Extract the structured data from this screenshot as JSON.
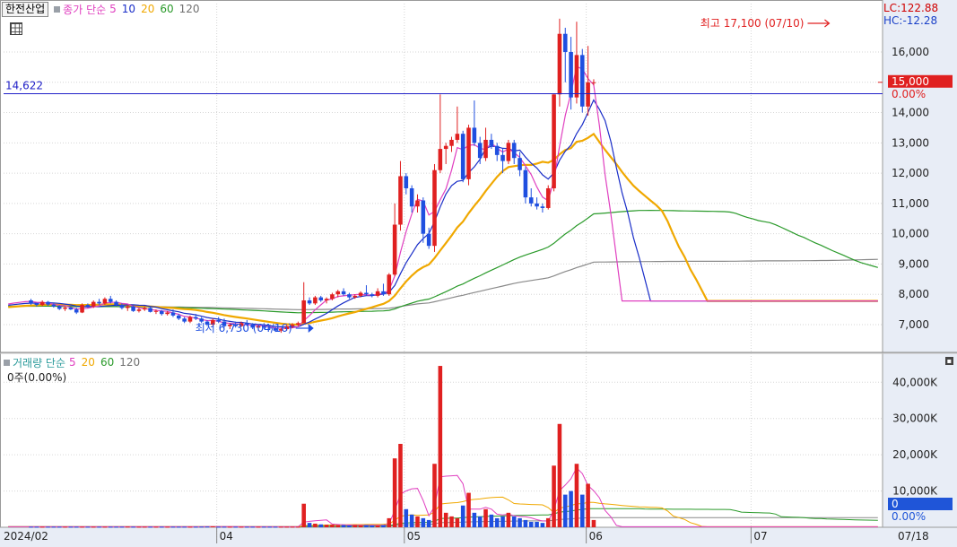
{
  "legend": {
    "stock_name": "한전산업",
    "price_label": "종가 단순",
    "ma": [
      "5",
      "10",
      "20",
      "60",
      "120"
    ]
  },
  "right_top": {
    "lc": "LC:122.88",
    "hc": "HC:-12.28"
  },
  "volume_legend": {
    "label": "거래량 단순",
    "ma": [
      "5",
      "20",
      "60",
      "120"
    ],
    "sub": "0주(0.00%)"
  },
  "colors": {
    "up": "#e02020",
    "down": "#1f4fe0",
    "ma5": "#e040c0",
    "ma10": "#1a2ec8",
    "ma20": "#f0a800",
    "ma60": "#2a9a2a",
    "ma120": "#8a8a8a",
    "hline": "#2020c8"
  },
  "chart_data": {
    "type": "candlestick",
    "price_axis": {
      "ticks": [
        "16,000",
        "15,000",
        "14,000",
        "13,000",
        "12,000",
        "11,000",
        "10,000",
        "9,000",
        "8,000",
        "7,000"
      ],
      "tick_values": [
        16000,
        15000,
        14000,
        13000,
        12000,
        11000,
        10000,
        9000,
        8000,
        7000
      ],
      "range": [
        6230,
        17480
      ]
    },
    "volume_axis": {
      "ticks": [
        "40,000K",
        "30,000K",
        "20,000K",
        "10,000K"
      ],
      "tick_values": [
        40000,
        30000,
        20000,
        10000
      ],
      "range": [
        0,
        46000
      ]
    },
    "x_labels": [
      "2024/02",
      "04",
      "05",
      "06",
      "07",
      "07/18"
    ],
    "x_label_index": [
      0,
      37,
      70,
      102,
      131,
      153
    ],
    "n_days": 154,
    "first_index": 4,
    "current_price": "15,000",
    "current_price_pct": "0.00%",
    "current_volume": "0",
    "current_volume_pct": "0.00%",
    "reference_line": {
      "value": 14622,
      "label": "14,622"
    },
    "high_annotation": {
      "text": "최고 17,100 (07/10)",
      "value": 17100,
      "index": 146
    },
    "low_annotation": {
      "text": "최저 6,730 (04/16)",
      "value": 6730,
      "index": 55
    },
    "candles": [
      [
        7800,
        7850,
        7650,
        7700
      ],
      [
        7700,
        7720,
        7600,
        7650
      ],
      [
        7650,
        7800,
        7600,
        7750
      ],
      [
        7750,
        7780,
        7620,
        7660
      ],
      [
        7660,
        7700,
        7560,
        7600
      ],
      [
        7600,
        7640,
        7480,
        7520
      ],
      [
        7520,
        7600,
        7450,
        7560
      ],
      [
        7560,
        7600,
        7480,
        7500
      ],
      [
        7500,
        7560,
        7350,
        7400
      ],
      [
        7400,
        7700,
        7380,
        7650
      ],
      [
        7650,
        7700,
        7550,
        7600
      ],
      [
        7600,
        7800,
        7550,
        7750
      ],
      [
        7750,
        7850,
        7650,
        7700
      ],
      [
        7700,
        7900,
        7650,
        7850
      ],
      [
        7850,
        7950,
        7700,
        7750
      ],
      [
        7750,
        7800,
        7600,
        7650
      ],
      [
        7650,
        7700,
        7500,
        7550
      ],
      [
        7550,
        7650,
        7450,
        7600
      ],
      [
        7600,
        7620,
        7420,
        7450
      ],
      [
        7450,
        7550,
        7400,
        7500
      ],
      [
        7500,
        7600,
        7450,
        7550
      ],
      [
        7550,
        7600,
        7400,
        7420
      ],
      [
        7420,
        7500,
        7350,
        7450
      ],
      [
        7450,
        7480,
        7300,
        7350
      ],
      [
        7350,
        7450,
        7300,
        7400
      ],
      [
        7400,
        7500,
        7250,
        7300
      ],
      [
        7300,
        7350,
        7150,
        7200
      ],
      [
        7200,
        7250,
        7050,
        7100
      ],
      [
        7100,
        7300,
        7050,
        7250
      ],
      [
        7250,
        7350,
        7150,
        7200
      ],
      [
        7200,
        7250,
        7050,
        7100
      ],
      [
        7100,
        7150,
        6950,
        7000
      ],
      [
        7000,
        7200,
        6950,
        7150
      ],
      [
        7150,
        7250,
        7050,
        7100
      ],
      [
        7100,
        7200,
        6900,
        6950
      ],
      [
        6950,
        7050,
        6850,
        7000
      ],
      [
        7000,
        7100,
        6900,
        6950
      ],
      [
        6950,
        7100,
        6920,
        7050
      ],
      [
        7050,
        7150,
        6950,
        7000
      ],
      [
        7000,
        7050,
        6850,
        6900
      ],
      [
        6900,
        7000,
        6800,
        6950
      ],
      [
        6950,
        7050,
        6850,
        6900
      ],
      [
        6900,
        7000,
        6820,
        6880
      ],
      [
        6880,
        6950,
        6760,
        6800
      ],
      [
        6800,
        6900,
        6730,
        6850
      ],
      [
        6850,
        7000,
        6800,
        6950
      ],
      [
        6950,
        7050,
        6880,
        7000
      ],
      [
        7000,
        7100,
        6950,
        7050
      ],
      [
        7050,
        8400,
        7050,
        7800
      ],
      [
        7800,
        7900,
        7650,
        7700
      ],
      [
        7700,
        7950,
        7650,
        7900
      ],
      [
        7900,
        7950,
        7750,
        7800
      ],
      [
        7800,
        7900,
        7700,
        7850
      ],
      [
        7850,
        8050,
        7800,
        8000
      ],
      [
        8000,
        8150,
        7900,
        8100
      ],
      [
        8100,
        8200,
        7950,
        8000
      ],
      [
        8000,
        8050,
        7850,
        7900
      ],
      [
        7900,
        8000,
        7850,
        7950
      ],
      [
        7950,
        8100,
        7900,
        8050
      ],
      [
        8050,
        8300,
        7950,
        8000
      ],
      [
        8000,
        8050,
        7900,
        7950
      ],
      [
        7950,
        8200,
        7900,
        8100
      ],
      [
        8100,
        8350,
        7950,
        8000
      ],
      [
        8000,
        8700,
        7950,
        8650
      ],
      [
        8650,
        11000,
        8600,
        10300
      ],
      [
        10300,
        12400,
        10100,
        11900
      ],
      [
        11900,
        12000,
        11300,
        11500
      ],
      [
        11500,
        11600,
        10700,
        10900
      ],
      [
        10900,
        11300,
        10700,
        11100
      ],
      [
        11100,
        11200,
        9700,
        10000
      ],
      [
        10000,
        10200,
        9500,
        9600
      ],
      [
        9600,
        12300,
        9400,
        12100
      ],
      [
        12100,
        14600,
        12000,
        12800
      ],
      [
        12800,
        13000,
        12300,
        12900
      ],
      [
        12900,
        13200,
        12700,
        13100
      ],
      [
        13100,
        14200,
        13000,
        13300
      ],
      [
        13300,
        13400,
        11700,
        11800
      ],
      [
        11800,
        13600,
        11600,
        13500
      ],
      [
        13500,
        14400,
        12900,
        13000
      ],
      [
        13000,
        13200,
        12300,
        12500
      ],
      [
        12500,
        13500,
        12400,
        13100
      ],
      [
        13100,
        13300,
        12800,
        12900
      ],
      [
        12900,
        13000,
        12400,
        12600
      ],
      [
        12600,
        12800,
        12000,
        12400
      ],
      [
        12400,
        13100,
        12300,
        13000
      ],
      [
        13000,
        13100,
        12300,
        12500
      ],
      [
        12500,
        12700,
        11900,
        12100
      ],
      [
        12100,
        12200,
        11000,
        11200
      ],
      [
        11200,
        11500,
        10900,
        11000
      ],
      [
        11000,
        11200,
        10800,
        10900
      ],
      [
        10900,
        11000,
        10700,
        10850
      ],
      [
        10850,
        11600,
        10800,
        11500
      ],
      [
        11500,
        14600,
        11400,
        14600
      ],
      [
        14600,
        17100,
        14200,
        16600
      ],
      [
        16600,
        16800,
        15000,
        16000
      ],
      [
        16000,
        16500,
        14100,
        14500
      ],
      [
        14500,
        17000,
        14300,
        15900
      ],
      [
        15900,
        16100,
        14000,
        14200
      ],
      [
        14200,
        16200,
        13900,
        15000
      ],
      [
        15000,
        15100,
        14900,
        15000
      ]
    ],
    "volume": [
      150,
      150,
      150,
      150,
      150,
      150,
      150,
      150,
      150,
      150,
      150,
      150,
      150,
      150,
      150,
      150,
      150,
      180,
      150,
      150,
      150,
      150,
      150,
      150,
      150,
      150,
      150,
      150,
      150,
      150,
      180,
      200,
      250,
      150,
      150,
      150,
      150,
      150,
      150,
      150,
      150,
      150,
      150,
      150,
      150,
      150,
      150,
      150,
      6500,
      1200,
      1000,
      800,
      700,
      700,
      600,
      600,
      500,
      600,
      500,
      600,
      500,
      500,
      600,
      2500,
      19000,
      23000,
      5000,
      3500,
      3000,
      2500,
      2000,
      17500,
      44500,
      4000,
      3000,
      2500,
      6000,
      9500,
      4000,
      3000,
      5000,
      3500,
      2500,
      3000,
      4000,
      3000,
      2500,
      2000,
      1500,
      1500,
      1200,
      2500,
      17000,
      28500,
      9000,
      10000,
      17500,
      9000,
      12000,
      2000
    ]
  }
}
